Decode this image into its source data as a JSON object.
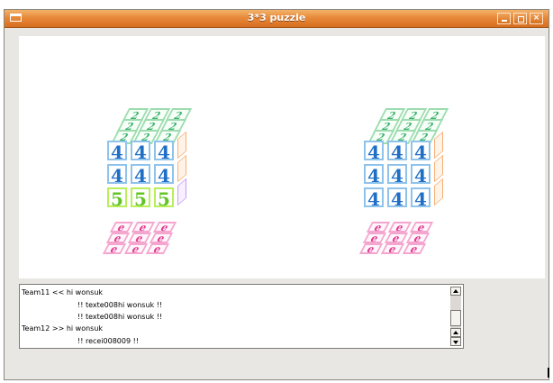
{
  "window": {
    "title": "3*3 puzzle",
    "controls": {
      "minimize": "minimize",
      "maximize": "maximize",
      "close": "close"
    }
  },
  "cubes": [
    {
      "name": "cube-left",
      "top_face": [
        "2",
        "2",
        "2",
        "2",
        "2",
        "2",
        "2",
        "2",
        "2"
      ],
      "front_face": [
        "4",
        "4",
        "4",
        "4",
        "4",
        "4",
        "5",
        "5",
        "5"
      ],
      "bottom_face": [
        "e",
        "e",
        "e",
        "e",
        "e",
        "e",
        "e",
        "e",
        "e"
      ]
    },
    {
      "name": "cube-right",
      "top_face": [
        "2",
        "2",
        "2",
        "2",
        "2",
        "2",
        "2",
        "2",
        "2"
      ],
      "front_face": [
        "4",
        "4",
        "4",
        "4",
        "4",
        "4",
        "4",
        "4",
        "4"
      ],
      "bottom_face": [
        "e",
        "e",
        "e",
        "e",
        "e",
        "e",
        "e",
        "e",
        "e"
      ]
    }
  ],
  "chat": {
    "lines": [
      "Team11 << hi wonsuk",
      "!! texte008hi wonsuk !!",
      "!! texte008hi wonsuk !!",
      "Team12 >> hi wonsuk",
      "!! recei008009 !!"
    ]
  },
  "colors": {
    "titlebar": "#e8893a",
    "front_blue": "#1f6fc6",
    "front_green": "#62c426",
    "top_green": "#3fb26e",
    "bottom_pink": "#e0338c"
  }
}
